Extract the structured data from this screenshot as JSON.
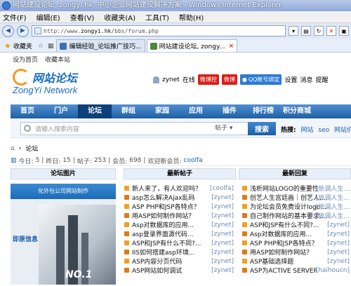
{
  "window": {
    "title": "网站建设论坛, zongyi.hk, 中小企业网站建设解决方案 - Windows Internet Explorer"
  },
  "menu": [
    "文件(F)",
    "编辑(E)",
    "查看(V)",
    "收藏夹(A)",
    "工具(T)",
    "帮助(H)"
  ],
  "address": {
    "url_prefix": "http://www.",
    "url_domain": "zongyi.hk",
    "url_path": "/bbs/forum.php"
  },
  "tabs": {
    "favorites": "收藏夹",
    "items": [
      {
        "label": "编辑经验_论坛推广技巧..."
      },
      {
        "label": "网站建设论坛, zongy..."
      }
    ]
  },
  "site": {
    "top_links": [
      "设为首页",
      "收藏本站"
    ],
    "logo_cn": "网站论坛",
    "logo_en": "ZongYi Network",
    "user": {
      "name": "zynet",
      "status": "在线",
      "weibo1": "微博控",
      "weibo2": "微博",
      "qq": "QQ帐号绑定",
      "links": [
        "设置",
        "消息",
        "提醒"
      ]
    }
  },
  "nav": [
    "首页",
    "门户",
    "论坛",
    "群组",
    "家园",
    "应用",
    "插件",
    "排行榜",
    "积分商城"
  ],
  "search": {
    "placeholder": "请输入搜索内容",
    "type": "帖子",
    "button": "搜索",
    "hot_label": "热搜:",
    "hot": [
      "网站",
      "seo",
      "网站价格"
    ]
  },
  "breadcrumb": {
    "home_icon": "home-icon",
    "sep": "›",
    "current": "论坛"
  },
  "stats": {
    "today_label": "今日:",
    "today": "5",
    "yesterday_label": "昨日:",
    "yesterday": "15",
    "posts_label": "帖子:",
    "posts": "253",
    "members_label": "会员:",
    "members": "698",
    "welcome": "欢迎新会员:",
    "new_member": "coolfa"
  },
  "columns": {
    "images": "论坛图片",
    "latest_posts": "最新帖子",
    "latest_replies": "最新回复"
  },
  "image_panel": {
    "banner": "化外包公司网站制作",
    "caption": "即原信息",
    "number": "NO.1"
  },
  "latest_posts": [
    {
      "title": "新人来了，有人欢迎吗？",
      "author": "[coolfa]"
    },
    {
      "title": "asp怎么解决Ajax乱码",
      "author": "[zynet]"
    },
    {
      "title": "ASP PHP和JSP各特点？",
      "author": "[zynet]"
    },
    {
      "title": "用ASP如何制作网站？",
      "author": "[zynet]"
    },
    {
      "title": "Asp对数据库的应用...",
      "author": "[zynet]"
    },
    {
      "title": "asp登录界面源代码...",
      "author": "[zynet]"
    },
    {
      "title": "ASP和JSP有什么不同?...",
      "author": "[zynet]"
    },
    {
      "title": "IIS如何搭建asp环境...",
      "author": "[zynet]"
    },
    {
      "title": "ASP内容分页代码",
      "author": "[zynet]"
    },
    {
      "title": "ASP网站如何调试",
      "author": "[zynet]"
    }
  ],
  "latest_replies": [
    {
      "title": "浅析网站LOGO的重要性",
      "author": "[依调人生..."
    },
    {
      "title": "创艺人生宫廷画｜创艺人...",
      "author": "[依调人生..."
    },
    {
      "title": "为论坛会员免费设计logo...",
      "author": "[依调人生..."
    },
    {
      "title": "自己制作网站的基本要求...",
      "author": "[依调人生..."
    },
    {
      "title": "ASP和JSP有什么不同?...",
      "author": "[zynet]"
    },
    {
      "title": "Asp对数据库的应用...",
      "author": "[zynet]"
    },
    {
      "title": "ASP PHP和JSP各特点？",
      "author": "[zynet]"
    },
    {
      "title": "用ASP如何制作网站？",
      "author": "[zynet]"
    },
    {
      "title": "ASP基础选择题",
      "author": "[zynet]"
    },
    {
      "title": "ASP为ACTIVE SERVER",
      "author": "[haihoucn]"
    }
  ]
}
